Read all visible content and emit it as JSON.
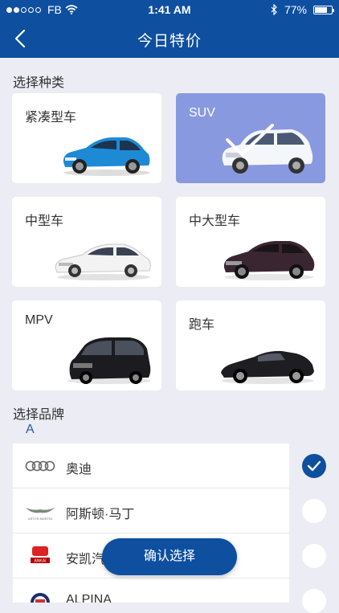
{
  "status_bar": {
    "carrier": "FB",
    "time": "1:41 AM",
    "battery": "77%",
    "battery_level": 0.77
  },
  "nav": {
    "title": "今日特价"
  },
  "category_section": {
    "label": "选择种类",
    "items": [
      {
        "label": "紧凑型车",
        "selected": false
      },
      {
        "label": "SUV",
        "selected": true
      },
      {
        "label": "中型车",
        "selected": false
      },
      {
        "label": "中大型车",
        "selected": false
      },
      {
        "label": "MPV",
        "selected": false
      },
      {
        "label": "跑车",
        "selected": false
      }
    ]
  },
  "brand_section": {
    "label": "选择品牌",
    "letter": "A",
    "items": [
      {
        "name": "奥迪",
        "checked": true
      },
      {
        "name": "阿斯顿·马丁",
        "checked": false
      },
      {
        "name": "安凯汽车",
        "checked": false
      },
      {
        "name": "ALPINA",
        "checked": false
      }
    ],
    "logo_text": {
      "aston_martin": "ASTON MARTIN",
      "ankai": "ANKAI"
    }
  },
  "confirm_button": {
    "label": "确认选择"
  },
  "colors": {
    "primary": "#0e4fa0",
    "selected_card": "#8899e0",
    "background": "#ececf4"
  }
}
